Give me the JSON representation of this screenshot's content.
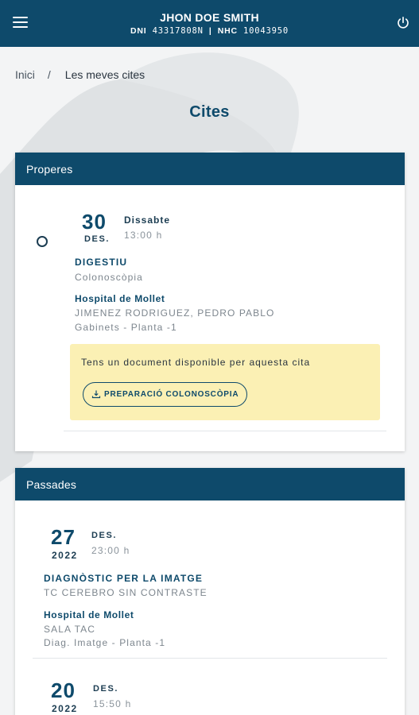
{
  "header": {
    "patient_name": "JHON DOE SMITH",
    "dni_label": "DNI",
    "dni_value": "43317808N",
    "nhc_label": "NHC",
    "nhc_value": "10043950",
    "separator": "|"
  },
  "breadcrumb": {
    "home": "Inici",
    "separator": "/",
    "current": "Les meves cites"
  },
  "page_title": "Cites",
  "upcoming": {
    "section_title": "Properes",
    "appointments": [
      {
        "day": "30",
        "month": "DES.",
        "weekday": "Dissabte",
        "time": "13:00 h",
        "service": "DIGESTIU",
        "procedure": "Colonoscòpia",
        "hospital": "Hospital de Mollet",
        "doctor": "JIMENEZ RODRIGUEZ, PEDRO PABLO",
        "location": "Gabinets - Planta -1",
        "document_notice": "Tens un document disponible per aquesta cita",
        "document_button": "PREPARACIÓ COLONOSCÒPIA"
      }
    ]
  },
  "past": {
    "section_title": "Passades",
    "appointments": [
      {
        "day": "27",
        "month": "DES.",
        "year": "2022",
        "time": "23:00 h",
        "service": "DIAGNÒSTIC PER LA IMATGE",
        "procedure": "TC CEREBRO SIN CONTRASTE",
        "hospital": "Hospital de Mollet",
        "room": "SALA TAC",
        "location": "Diag. Imatge - Planta -1"
      },
      {
        "day": "20",
        "month": "DES.",
        "year": "2022",
        "time": "15:50 h"
      }
    ]
  },
  "colors": {
    "primary": "#0e4a6b",
    "notice_bg": "#fbf0b4",
    "background": "#f3f4f5"
  },
  "icons": {
    "menu": "hamburger-icon",
    "logout": "power-icon",
    "download": "download-icon",
    "select": "radio-icon"
  }
}
